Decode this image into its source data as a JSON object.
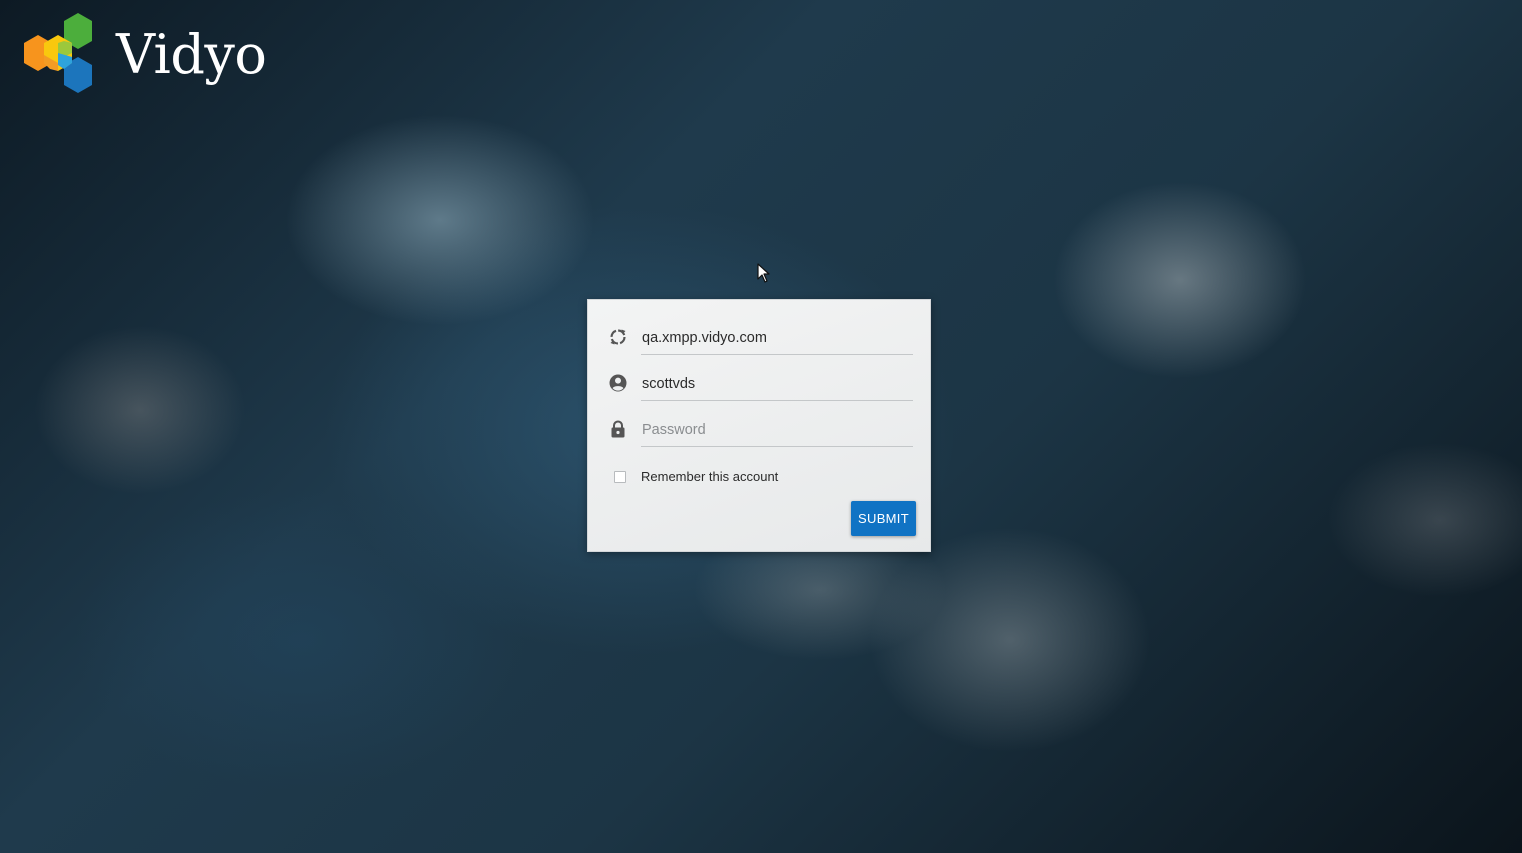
{
  "brand": {
    "name": "Vidyo",
    "logo_icon": "vidyo-hexagon-logo",
    "colors": {
      "orange": "#f7941d",
      "yellow": "#f9c80e",
      "green": "#4cae3c",
      "light_green": "#9cc83c",
      "blue": "#1c75bc",
      "light_blue": "#2ea3dc"
    }
  },
  "login": {
    "server": {
      "icon": "sync-icon",
      "value": "qa.xmpp.vidyo.com"
    },
    "username": {
      "icon": "user-circle-icon",
      "value": "scottvds"
    },
    "password": {
      "icon": "lock-icon",
      "placeholder": "Password",
      "value": ""
    },
    "remember": {
      "label": "Remember this account",
      "checked": false
    },
    "submit_label": "SUBMIT",
    "accent_color": "#1073c4"
  }
}
